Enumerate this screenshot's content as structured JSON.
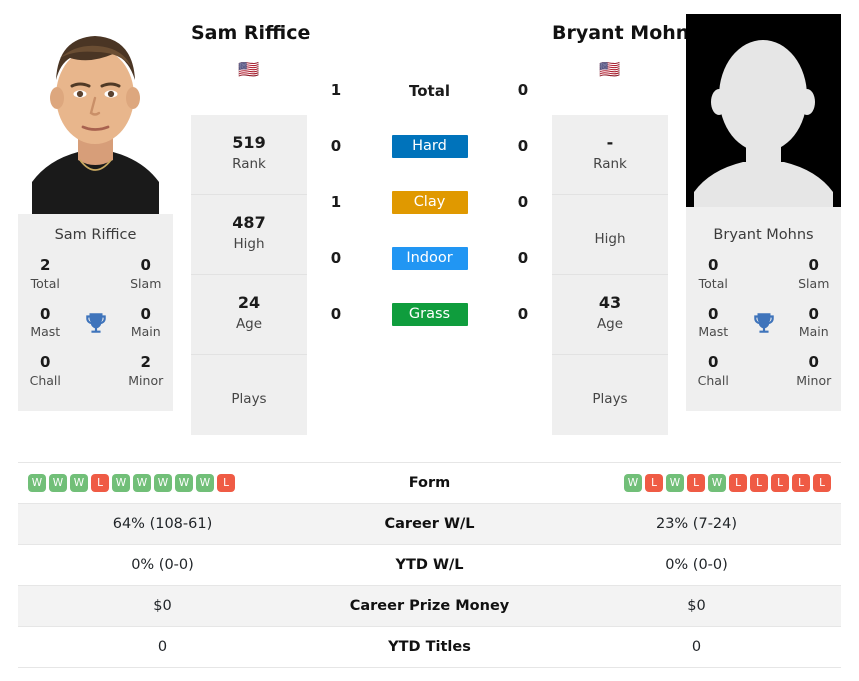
{
  "players": {
    "left": {
      "name": "Sam Riffice",
      "flag": "🇺🇸",
      "flag_name": "flag-united-states",
      "photo_type": "portrait-photo",
      "card_name": "Sam Riffice",
      "titles": {
        "total": "2",
        "total_label": "Total",
        "slam": "0",
        "slam_label": "Slam",
        "mast": "0",
        "mast_label": "Mast",
        "main": "0",
        "main_label": "Main",
        "chall": "0",
        "chall_label": "Chall",
        "minor": "2",
        "minor_label": "Minor"
      },
      "stats": [
        {
          "value": "519",
          "label": "Rank"
        },
        {
          "value": "487",
          "label": "High"
        },
        {
          "value": "24",
          "label": "Age"
        },
        {
          "value": "",
          "label": "Plays"
        }
      ],
      "form": [
        "W",
        "W",
        "W",
        "L",
        "W",
        "W",
        "W",
        "W",
        "W",
        "L"
      ],
      "career_wl": "64% (108-61)",
      "ytd_wl": "0% (0-0)",
      "career_prize_money": "$0",
      "ytd_titles": "0"
    },
    "right": {
      "name": "Bryant Mohns",
      "flag": "🇺🇸",
      "flag_name": "flag-united-states",
      "photo_type": "placeholder-silhouette",
      "card_name": "Bryant Mohns",
      "titles": {
        "total": "0",
        "total_label": "Total",
        "slam": "0",
        "slam_label": "Slam",
        "mast": "0",
        "mast_label": "Mast",
        "main": "0",
        "main_label": "Main",
        "chall": "0",
        "chall_label": "Chall",
        "minor": "0",
        "minor_label": "Minor"
      },
      "stats": [
        {
          "value": "-",
          "label": "Rank"
        },
        {
          "value": "",
          "label": "High"
        },
        {
          "value": "43",
          "label": "Age"
        },
        {
          "value": "",
          "label": "Plays"
        }
      ],
      "form": [
        "W",
        "L",
        "W",
        "L",
        "W",
        "L",
        "L",
        "L",
        "L",
        "L"
      ],
      "career_wl": "23% (7-24)",
      "ytd_wl": "0% (0-0)",
      "career_prize_money": "$0",
      "ytd_titles": "0"
    }
  },
  "head_to_head": [
    {
      "label": "Total",
      "type": "text",
      "left": "1",
      "right": "0",
      "color": ""
    },
    {
      "label": "Hard",
      "type": "badge",
      "left": "0",
      "right": "0",
      "color": "#0073BB"
    },
    {
      "label": "Clay",
      "type": "badge",
      "left": "1",
      "right": "0",
      "color": "#E09900"
    },
    {
      "label": "Indoor",
      "type": "badge",
      "left": "0",
      "right": "0",
      "color": "#2196F3"
    },
    {
      "label": "Grass",
      "type": "badge",
      "left": "0",
      "right": "0",
      "color": "#0F9D3D"
    }
  ],
  "table_rows": [
    {
      "label": "Form",
      "type": "form",
      "left": "",
      "right": "",
      "alt": false
    },
    {
      "label": "Career W/L",
      "type": "text",
      "left": "64% (108-61)",
      "right": "23% (7-24)",
      "alt": true
    },
    {
      "label": "YTD W/L",
      "type": "text",
      "left": "0% (0-0)",
      "right": "0% (0-0)",
      "alt": false
    },
    {
      "label": "Career Prize Money",
      "type": "text",
      "left": "$0",
      "right": "$0",
      "alt": true
    },
    {
      "label": "YTD Titles",
      "type": "text",
      "left": "0",
      "right": "0",
      "alt": false
    }
  ],
  "colors": {
    "hard": "#0073BB",
    "clay": "#E09900",
    "indoor": "#2196F3",
    "grass": "#0F9D3D",
    "win": "#71bf78",
    "loss": "#ef5b45",
    "trophy": "#3f74bb",
    "card_bg": "#efefef"
  }
}
